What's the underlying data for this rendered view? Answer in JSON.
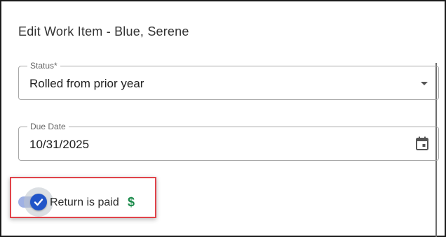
{
  "dialog": {
    "title": "Edit Work Item - Blue, Serene"
  },
  "status_field": {
    "label": "Status*",
    "value": "Rolled from prior year",
    "icon": "dropdown-caret-icon"
  },
  "due_date_field": {
    "label": "Due Date",
    "value": "10/31/2025",
    "icon": "calendar-icon"
  },
  "return_paid_toggle": {
    "label": "Return is paid",
    "checked": true,
    "adornment": "$",
    "adornment_icon": "dollar-icon"
  },
  "colors": {
    "accent": "#2155c8",
    "track": "#9fb1e4",
    "highlight_border": "#e0434a",
    "dollar": "#1a8a4a"
  }
}
